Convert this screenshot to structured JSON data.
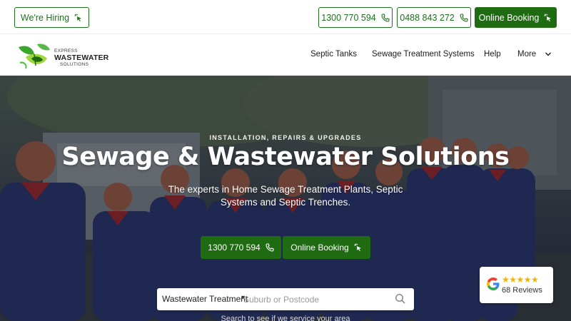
{
  "topbar": {
    "hiring_label": "We're Hiring",
    "phone_1": "1300 770 594",
    "phone_2": "0488 843 272",
    "booking_label": "Online Booking"
  },
  "logo": {
    "line_1": "EXPRESS",
    "line_2": "WASTEWATER",
    "line_3": "SOLUTIONS"
  },
  "nav": {
    "items": [
      "Septic Tanks",
      "Sewage Treatment Systems",
      "Help",
      "More"
    ]
  },
  "hero": {
    "eyebrow": "INSTALLATION, REPAIRS & UPGRADES",
    "title": "Sewage & Wastewater Solutions",
    "subtitle": "The experts in Home Sewage Treatment Plants, Septic Systems and Septic Trenches.",
    "phone_label": "1300 770 594",
    "booking_label": "Online Booking"
  },
  "search": {
    "category_value": "Wastewater Treatment",
    "placeholder": "Suburb or Postcode",
    "hint": "Search to see if we service your area"
  },
  "reviews": {
    "stars": "★★★★★",
    "count_label": "68 Reviews"
  },
  "colors": {
    "brand_green": "#1e6b12",
    "outline_green": "#1e6f1e",
    "star_color": "#f5b301"
  },
  "icons": [
    "cursor-click-icon",
    "phone-icon",
    "chevron-down-icon",
    "search-icon",
    "google-icon",
    "leaf-logo-icon"
  ]
}
